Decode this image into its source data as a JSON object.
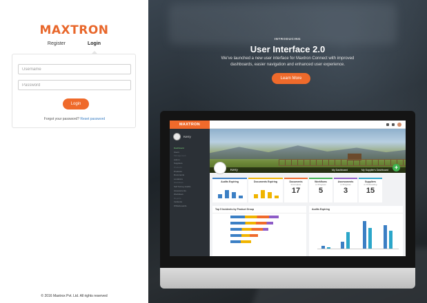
{
  "brand": {
    "logo": "MAXTRON",
    "accent": "#ef6a2b"
  },
  "tabs": [
    {
      "label": "Register",
      "active": false
    },
    {
      "label": "Login",
      "active": true
    }
  ],
  "login": {
    "username_placeholder": "Username",
    "password_placeholder": "Password",
    "submit_label": "Login",
    "forgot_text": "Forgot your password?",
    "reset_link": "Reset password"
  },
  "footer": {
    "copyright": "© 2016 Maxtrox Pvt. Ltd. All rights reserved"
  },
  "promo": {
    "eyebrow": "INTRODUCING",
    "headline": "User Interface 2.0",
    "subtext": "We've launched a new user interface for Maxtron Connect with improved dashboards, easier navigation and enhanced user experience.",
    "cta": "Learn More"
  },
  "preview": {
    "app_logo": "MAXTRON",
    "user": "Kerry",
    "banner_tab_1": "My Dashboard",
    "banner_tab_2": "My Supplier's Dashboard",
    "nav": [
      {
        "label": "Dashboard",
        "state": "on"
      },
      {
        "label": "Users",
        "state": ""
      },
      {
        "label": "Management",
        "state": "hdr"
      },
      {
        "label": "Admin",
        "state": ""
      },
      {
        "label": "Suppliers",
        "state": ""
      },
      {
        "label": "Products",
        "state": "hdr"
      },
      {
        "label": "Products",
        "state": ""
      },
      {
        "label": "Documents",
        "state": ""
      },
      {
        "label": "Locations",
        "state": ""
      },
      {
        "label": "Workflows",
        "state": "hdr"
      },
      {
        "label": "Self Survey Audits",
        "state": ""
      },
      {
        "label": "Assessments",
        "state": ""
      },
      {
        "label": "Workflows",
        "state": ""
      },
      {
        "label": "Reports",
        "state": "hdr"
      },
      {
        "label": "Incidents",
        "state": ""
      },
      {
        "label": "Whitebooards",
        "state": ""
      }
    ],
    "stats": [
      {
        "title": "Audits Expiring",
        "sub": "",
        "value": "",
        "color": "#3b7fc4"
      },
      {
        "title": "Documents Expiring",
        "sub": "",
        "value": "",
        "color": "#f0b400"
      },
      {
        "title": "Documents",
        "sub": "Incomplete",
        "value": "17",
        "color": "#ef6a2b"
      },
      {
        "title": "Workflows",
        "sub": "in Progress",
        "value": "5",
        "color": "#3fb34f"
      },
      {
        "title": "Assessments",
        "sub": "in Progress",
        "value": "3",
        "color": "#8e5cc7"
      },
      {
        "title": "Suppliers",
        "sub": "in Onboarding",
        "value": "15",
        "color": "#2ba6c9"
      }
    ],
    "panels": [
      {
        "title": "Top 5 Incidents by Product Group"
      },
      {
        "title": "Audits Expiring"
      }
    ]
  }
}
